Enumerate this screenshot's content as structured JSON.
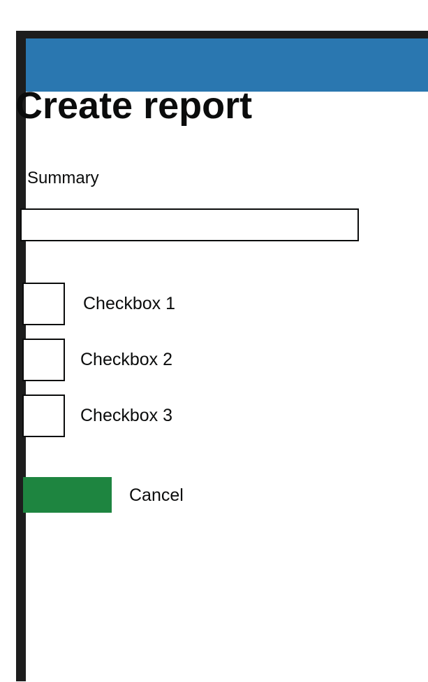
{
  "header": {
    "color": "#2a77b0"
  },
  "page": {
    "title": "Create report"
  },
  "form": {
    "summary": {
      "label": "Summary",
      "value": "",
      "placeholder": ""
    },
    "checkboxes": [
      {
        "label": "Checkbox 1",
        "checked": false
      },
      {
        "label": "Checkbox 2",
        "checked": false
      },
      {
        "label": "Checkbox 3",
        "checked": false
      }
    ],
    "submit_button": {
      "label": "",
      "color": "#1e8540"
    },
    "cancel_label": "Cancel"
  }
}
